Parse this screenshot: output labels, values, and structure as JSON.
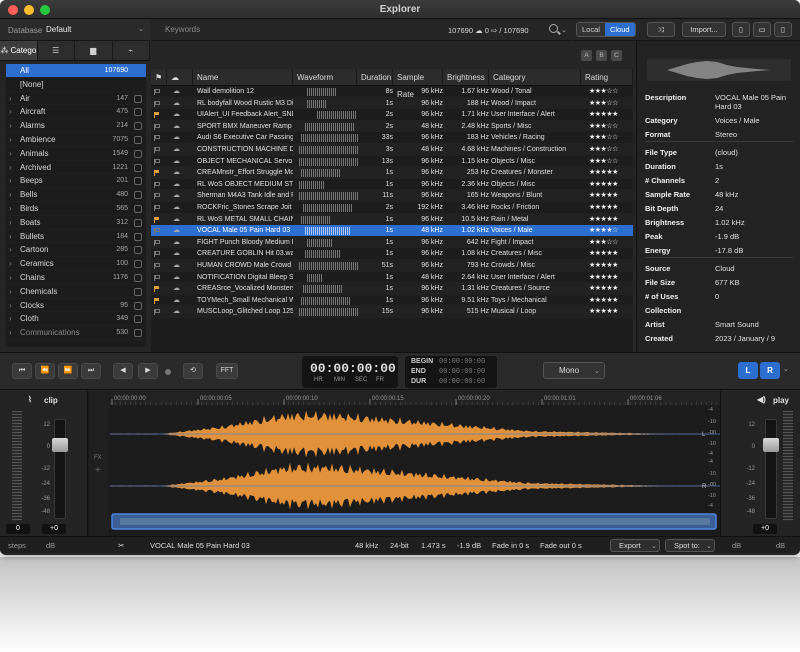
{
  "window": {
    "title": "Explorer"
  },
  "database": {
    "label": "Database",
    "value": "Default"
  },
  "sidebar_tabs": [
    {
      "label": "Catego",
      "icon": "tree-icon"
    },
    {
      "icon": "list-icon"
    },
    {
      "icon": "folder-icon"
    },
    {
      "icon": "waveform-icon"
    }
  ],
  "categories": [
    {
      "name": "All",
      "count": "107690",
      "selected": true
    },
    {
      "name": "[None]",
      "count": ""
    },
    {
      "name": "Air",
      "count": "147"
    },
    {
      "name": "Aircraft",
      "count": "475"
    },
    {
      "name": "Alarms",
      "count": "214"
    },
    {
      "name": "Ambience",
      "count": "7075"
    },
    {
      "name": "Animals",
      "count": "1549"
    },
    {
      "name": "Archived",
      "count": "1221"
    },
    {
      "name": "Beeps",
      "count": "201"
    },
    {
      "name": "Bells",
      "count": "480"
    },
    {
      "name": "Birds",
      "count": "565"
    },
    {
      "name": "Boats",
      "count": "312"
    },
    {
      "name": "Bullets",
      "count": "184"
    },
    {
      "name": "Cartoon",
      "count": "285"
    },
    {
      "name": "Ceramics",
      "count": "100"
    },
    {
      "name": "Chains",
      "count": "1176"
    },
    {
      "name": "Chemicals",
      "count": ""
    },
    {
      "name": "Clocks",
      "count": "95"
    },
    {
      "name": "Cloth",
      "count": "349"
    },
    {
      "name": "Communications",
      "count": "530"
    }
  ],
  "keywords": {
    "label": "Keywords",
    "result_count": "107690",
    "cloud_count": "0",
    "total": "/ 107690"
  },
  "toolbar": {
    "local_label": "Local",
    "cloud_label": "Cloud",
    "import_label": "Import...",
    "shuffle_icon": "shuffle-icon"
  },
  "abc_filters": [
    "A",
    "B",
    "C"
  ],
  "table": {
    "columns": [
      "Name",
      "Waveform",
      "Duration",
      "Sample Rate",
      "Brightness",
      "Category",
      "Rating"
    ],
    "rows": [
      {
        "flag": "o",
        "name": "Wall demolition 12",
        "duration": "8s",
        "sr": "96 kHz",
        "bright": "1.67 kHz",
        "cat": "Wood / Tonal",
        "rating": "★★★☆☆",
        "wf": [
          10,
          30
        ]
      },
      {
        "flag": "o",
        "name": "RL bodyfall Wood Rustic M3 Dis",
        "duration": "1s",
        "sr": "96 kHz",
        "bright": "188 Hz",
        "cat": "Wood / Impact",
        "rating": "★★★☆☆",
        "wf": [
          10,
          20
        ]
      },
      {
        "flag": "f",
        "name": "UIAlert_UI Feedback Alert_SND",
        "duration": "2s",
        "sr": "96 kHz",
        "bright": "1.71 kHz",
        "cat": "User Interface / Alert",
        "rating": "★★★★★",
        "wf": [
          20,
          40
        ]
      },
      {
        "flag": "o",
        "name": "SPORT BMX Maneuver Ramp L",
        "duration": "2s",
        "sr": "48 kHz",
        "bright": "2.48 kHz",
        "cat": "Sports / Misc",
        "rating": "★★★☆☆",
        "wf": [
          8,
          50
        ]
      },
      {
        "flag": "o",
        "name": "Audi S6 Executive Car Passing",
        "duration": "33s",
        "sr": "96 kHz",
        "bright": "183 Hz",
        "cat": "Vehicles / Racing",
        "rating": "★★★☆☆",
        "wf": [
          4,
          58
        ]
      },
      {
        "flag": "o",
        "name": "CONSTRUCTION MACHINE Drill",
        "duration": "3s",
        "sr": "48 kHz",
        "bright": "4.68 kHz",
        "cat": "Machines / Construction",
        "rating": "★★★☆☆",
        "wf": [
          2,
          60
        ]
      },
      {
        "flag": "o",
        "name": "OBJECT MECHANICAL Servo Bl",
        "duration": "13s",
        "sr": "96 kHz",
        "bright": "1.15 kHz",
        "cat": "Objects / Misc",
        "rating": "★★★☆☆",
        "wf": [
          2,
          60
        ]
      },
      {
        "flag": "f",
        "name": "CREAMnstr_Effort Struggle Mo",
        "duration": "1s",
        "sr": "96 kHz",
        "bright": "253 Hz",
        "cat": "Creatures / Monster",
        "rating": "★★★★★",
        "wf": [
          4,
          40
        ]
      },
      {
        "flag": "o",
        "name": "RL WoS OBJECT MEDIUM STO",
        "duration": "1s",
        "sr": "96 kHz",
        "bright": "2.36 kHz",
        "cat": "Objects / Misc",
        "rating": "★★★★★",
        "wf": [
          2,
          25
        ]
      },
      {
        "flag": "o",
        "name": "Sherman M4A3 Tank Idle and R",
        "duration": "11s",
        "sr": "96 kHz",
        "bright": "165 Hz",
        "cat": "Weapons / Blunt",
        "rating": "★★★★★",
        "wf": [
          2,
          60
        ]
      },
      {
        "flag": "o",
        "name": "ROCKFric_Stones Scrape Joit 0",
        "duration": "2s",
        "sr": "192 kHz",
        "bright": "3.46 kHz",
        "cat": "Rocks / Friction",
        "rating": "★★★★★",
        "wf": [
          6,
          50
        ]
      },
      {
        "flag": "f",
        "name": "RL WoS METAL SMALL CHAIN",
        "duration": "1s",
        "sr": "96 kHz",
        "bright": "10.5 kHz",
        "cat": "Rain / Metal",
        "rating": "★★★★★",
        "wf": [
          4,
          30
        ]
      },
      {
        "flag": "o",
        "name": "VOCAL Male 05 Pain Hard 03",
        "duration": "1s",
        "sr": "48 kHz",
        "bright": "1.02 kHz",
        "cat": "Voices / Male",
        "rating": "★★★★☆",
        "wf": [
          8,
          45
        ],
        "selected": true
      },
      {
        "flag": "o",
        "name": "FIGHT Punch Bloody Medium L",
        "duration": "1s",
        "sr": "96 kHz",
        "bright": "642 Hz",
        "cat": "Fight / Impact",
        "rating": "★★★☆☆",
        "wf": [
          10,
          25
        ]
      },
      {
        "flag": "o",
        "name": "CREATURE GOBLIN Hit 03.wav",
        "duration": "1s",
        "sr": "96 kHz",
        "bright": "1.08 kHz",
        "cat": "Creatures / Misc",
        "rating": "★★★★★",
        "wf": [
          8,
          35
        ]
      },
      {
        "flag": "o",
        "name": "HUMAN CROWD Male Crowd H",
        "duration": "51s",
        "sr": "96 kHz",
        "bright": "793 Hz",
        "cat": "Crowds / Misc",
        "rating": "★★★★★",
        "wf": [
          2,
          60
        ]
      },
      {
        "flag": "o",
        "name": "NOTIFICATION Digital Bleep Shr",
        "duration": "1s",
        "sr": "48 kHz",
        "bright": "2.64 kHz",
        "cat": "User Interface / Alert",
        "rating": "★★★★★",
        "wf": [
          10,
          15
        ]
      },
      {
        "flag": "f",
        "name": "CREASrce_Vocalized Monsters",
        "duration": "1s",
        "sr": "96 kHz",
        "bright": "1.31 kHz",
        "cat": "Creatures / Source",
        "rating": "★★★★★",
        "wf": [
          6,
          40
        ]
      },
      {
        "flag": "f",
        "name": "TOYMech_Small Mechanical Wi",
        "duration": "1s",
        "sr": "96 kHz",
        "bright": "9.51 kHz",
        "cat": "Toys / Mechanical",
        "rating": "★★★★★",
        "wf": [
          4,
          50
        ]
      },
      {
        "flag": "o",
        "name": "MUSCLoop_Glitched Loop 125",
        "duration": "15s",
        "sr": "96 kHz",
        "bright": "515 Hz",
        "cat": "Musical / Loop",
        "rating": "★★★★★",
        "wf": [
          2,
          60
        ]
      }
    ]
  },
  "inspector": {
    "groups": [
      [
        {
          "k": "Description",
          "v": "VOCAL Male 05 Pain Hard 03"
        },
        {
          "k": "Category",
          "v": "Voices / Male"
        },
        {
          "k": "Format",
          "v": "Stereo"
        }
      ],
      [
        {
          "k": "File Type",
          "v": "(cloud)"
        },
        {
          "k": "Duration",
          "v": "1s"
        },
        {
          "k": "# Channels",
          "v": "2"
        },
        {
          "k": "Sample Rate",
          "v": "48 kHz"
        },
        {
          "k": "Bit Depth",
          "v": "24"
        },
        {
          "k": "Brightness",
          "v": "1.02 kHz"
        },
        {
          "k": "Peak",
          "v": "-1.9 dB"
        },
        {
          "k": "Energy",
          "v": "-17.8 dB"
        }
      ],
      [
        {
          "k": "Source",
          "v": "Cloud"
        },
        {
          "k": "File Size",
          "v": "677 KB"
        },
        {
          "k": "# of Uses",
          "v": "0"
        },
        {
          "k": "Collection",
          "v": ""
        },
        {
          "k": "Artist",
          "v": "Smart Sound"
        },
        {
          "k": "Created",
          "v": "2023 / January / 9"
        }
      ]
    ]
  },
  "transport": {
    "buttons": [
      "⏮",
      "⏪",
      "⏩",
      "⏭",
      "◀",
      "▶",
      "●",
      "⟲"
    ],
    "fft_label": "FFT",
    "time": "00:00:00:00",
    "time_units": [
      "HR",
      "MIN",
      "SEC",
      "FR"
    ],
    "begin_label": "BEGIN",
    "end_label": "END",
    "dur_label": "DUR",
    "begin": "00:00:00:00",
    "end": "00:00:00:00",
    "dur": "00:00:00:00",
    "mode": "Mono",
    "channels": [
      "L",
      "R"
    ]
  },
  "clip_panel": {
    "title": "clip",
    "value": "0",
    "gain": "+0",
    "steps_label": "steps",
    "db_label": "dB",
    "scale": [
      "12",
      "0",
      "-12",
      "-24",
      "-36",
      "-48"
    ]
  },
  "play_panel": {
    "title": "play",
    "gain": "+0",
    "db_label": "dB",
    "scale": [
      "12",
      "0",
      "-12",
      "-24",
      "-36",
      "-48"
    ]
  },
  "waveform": {
    "timeline": [
      "00:00:00:00",
      "00:00:00:05",
      "00:00:00:10",
      "00:00:00:15",
      "00:00:00:20",
      "00:00:01:01",
      "00:00:01:06"
    ],
    "channel_labels": [
      "L",
      "R"
    ],
    "db_scale": [
      "-4",
      "-10",
      "-00",
      "-10",
      "-4"
    ],
    "color": "#e0913a",
    "fx_label": "FX"
  },
  "status": {
    "name": "VOCAL Male 05 Pain Hard 03",
    "sr": "48 kHz",
    "bits": "24-bit",
    "length": "1.473 s",
    "peak": "-1.9 dB",
    "fade_in": "Fade in 0 s",
    "fade_out": "Fade out 0 s",
    "export_label": "Export",
    "spot_label": "Spot to:",
    "db_label": "dB"
  },
  "colors": {
    "accent": "#2d6fd1",
    "waveform": "#e0913a",
    "background": "#262626"
  }
}
